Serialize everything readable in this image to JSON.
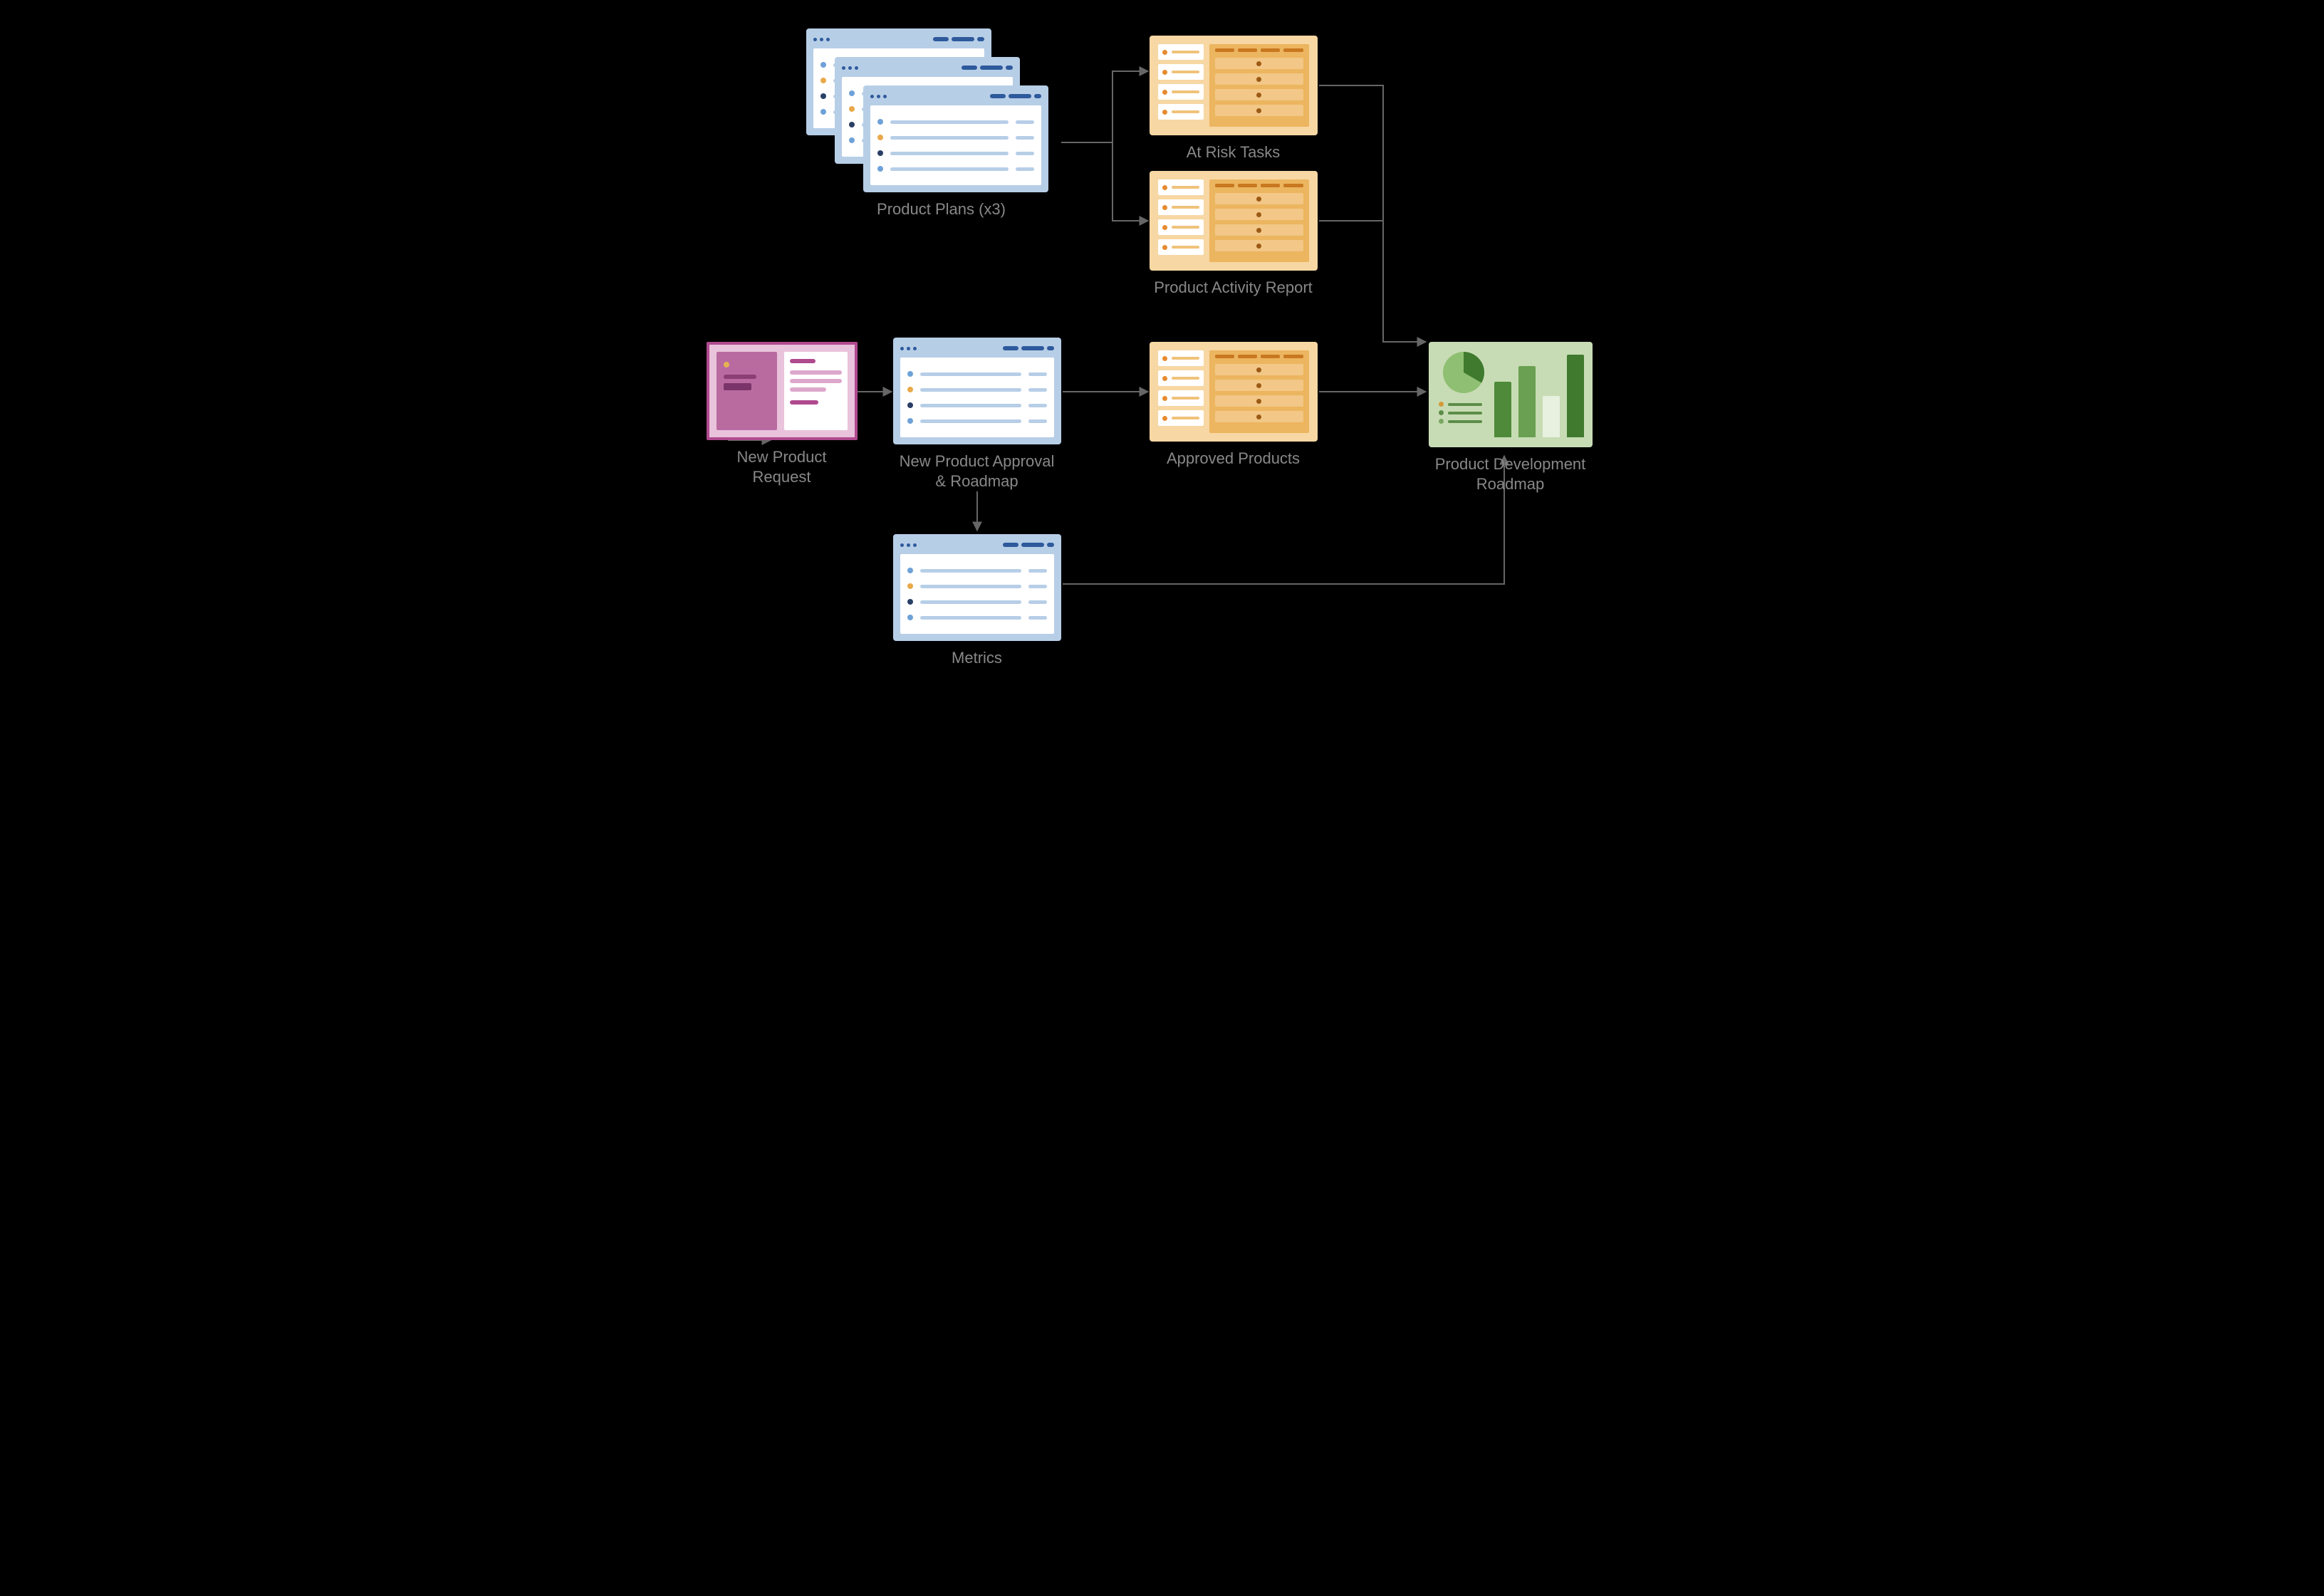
{
  "nodes": {
    "product_plans": {
      "label": "Product Plans (x3)"
    },
    "at_risk": {
      "label": "At Risk Tasks"
    },
    "activity_report": {
      "label": "Product Activity Report"
    },
    "new_request": {
      "label": "New Product Request"
    },
    "approval": {
      "label": "New Product Approval & Roadmap"
    },
    "approved": {
      "label": "Approved Products"
    },
    "metrics": {
      "label": "Metrics"
    },
    "roadmap": {
      "label": "Product Development Roadmap"
    }
  },
  "edges": [
    {
      "from": "product_plans",
      "to": "at_risk"
    },
    {
      "from": "product_plans",
      "to": "activity_report"
    },
    {
      "from": "at_risk",
      "to": "roadmap"
    },
    {
      "from": "activity_report",
      "to": "roadmap"
    },
    {
      "from": "new_request",
      "to": "approval"
    },
    {
      "from": "approval",
      "to": "approved"
    },
    {
      "from": "approved",
      "to": "roadmap"
    },
    {
      "from": "approval",
      "to": "metrics"
    },
    {
      "from": "metrics",
      "to": "roadmap"
    }
  ],
  "colors": {
    "sheet_bg": "#b7cee7",
    "report_bg": "#f7d7a3",
    "request_border": "#b04a8f",
    "dash_bg": "#c7dcb4",
    "caption": "#888888",
    "connector": "#666666"
  }
}
